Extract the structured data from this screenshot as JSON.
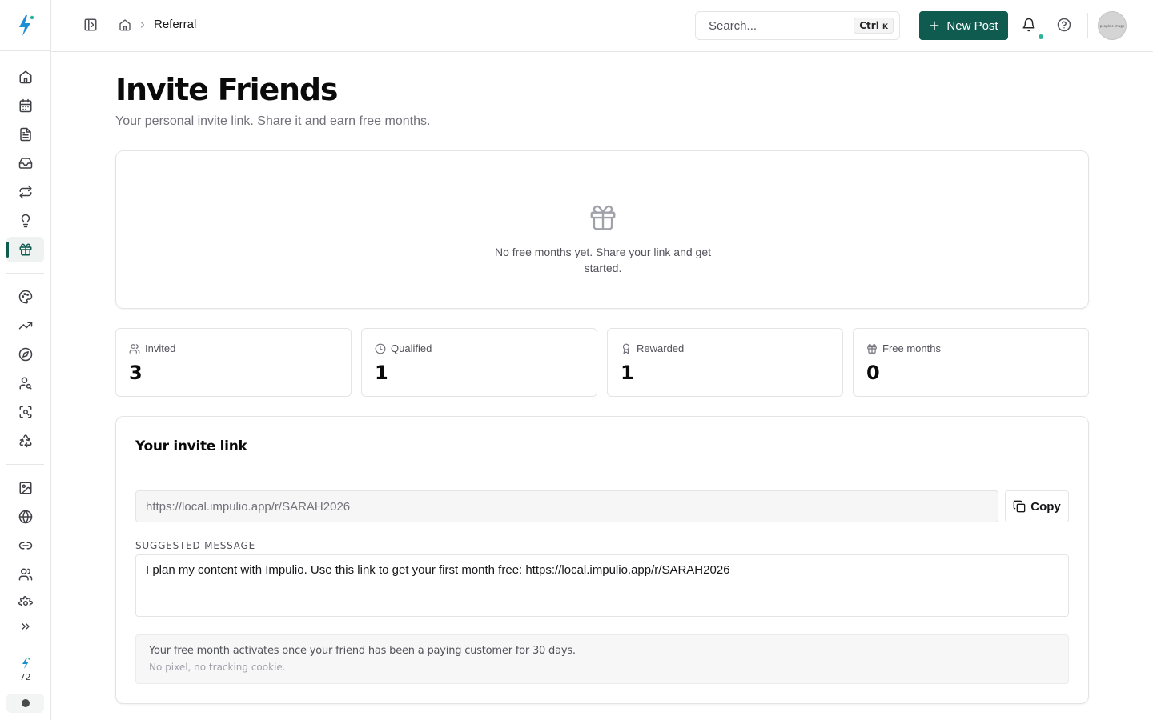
{
  "app": {
    "logo_icon": "bolt-sparkle-icon",
    "accent_color": "#0f5b4f",
    "brand_color": "#1b8fd4"
  },
  "sidebar": {
    "groups": [
      [
        "home-icon",
        "calendar-icon",
        "document-icon",
        "inbox-icon",
        "repeat-icon",
        "lightbulb-icon",
        "gift-icon"
      ],
      [
        "palette-icon",
        "trending-up-icon",
        "compass-icon",
        "user-search-icon",
        "scan-search-icon",
        "recycle-icon"
      ],
      [
        "image-icon",
        "globe-icon",
        "link-icon",
        "users-icon",
        "settings-icon"
      ]
    ],
    "active": "gift-icon",
    "expand_icon": "chevrons-right-icon",
    "credits": "72"
  },
  "header": {
    "breadcrumb_current": "Referral",
    "search_placeholder": "Search...",
    "shortcut_ctrl": "Ctrl",
    "shortcut_key": "K",
    "new_post_label": "New Post",
    "avatar_text": "people's image"
  },
  "page": {
    "title": "Invite Friends",
    "subtitle": "Your personal invite link. Share it and earn free months."
  },
  "empty_state": {
    "icon": "gift-icon",
    "text": "No free months yet. Share your link and get started."
  },
  "stats": [
    {
      "icon": "users-icon",
      "label": "Invited",
      "value": "3"
    },
    {
      "icon": "clock-icon",
      "label": "Qualified",
      "value": "1"
    },
    {
      "icon": "award-icon",
      "label": "Rewarded",
      "value": "1"
    },
    {
      "icon": "gift-icon",
      "label": "Free months",
      "value": "0"
    }
  ],
  "invite": {
    "title": "Your invite link",
    "link": "https://local.impulio.app/r/SARAH2026",
    "copy_label": "Copy",
    "suggested_label": "SUGGESTED MESSAGE",
    "suggested_message": "I plan my content with Impulio. Use this link to get your first month free: https://local.impulio.app/r/SARAH2026",
    "note_line1": "Your free month activates once your friend has been a paying customer for 30 days.",
    "note_line2": "No pixel, no tracking cookie."
  }
}
